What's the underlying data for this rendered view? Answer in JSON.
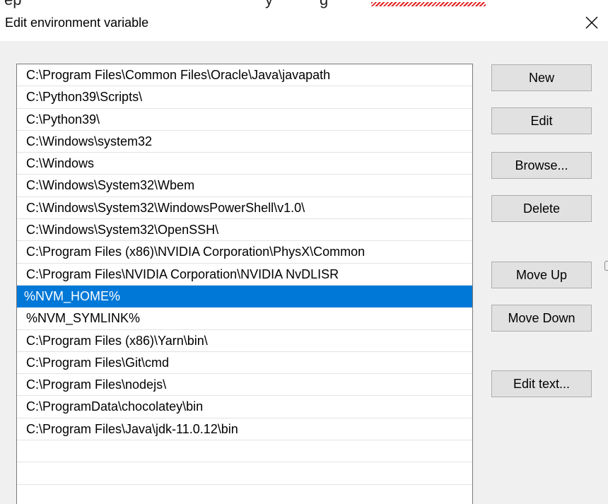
{
  "window": {
    "title": "Edit environment variable",
    "close_icon": "close-icon"
  },
  "top_fragment": {
    "left_text": "ep",
    "mid_text": "y",
    "right_text": "g"
  },
  "path_list": {
    "selected_index": 10,
    "items": [
      "C:\\Program Files\\Common Files\\Oracle\\Java\\javapath",
      "C:\\Python39\\Scripts\\",
      "C:\\Python39\\",
      "C:\\Windows\\system32",
      "C:\\Windows",
      "C:\\Windows\\System32\\Wbem",
      "C:\\Windows\\System32\\WindowsPowerShell\\v1.0\\",
      "C:\\Windows\\System32\\OpenSSH\\",
      "C:\\Program Files (x86)\\NVIDIA Corporation\\PhysX\\Common",
      "C:\\Program Files\\NVIDIA Corporation\\NVIDIA NvDLISR",
      "%NVM_HOME%",
      "%NVM_SYMLINK%",
      "C:\\Program Files (x86)\\Yarn\\bin\\",
      "C:\\Program Files\\Git\\cmd",
      "C:\\Program Files\\nodejs\\",
      "C:\\ProgramData\\chocolatey\\bin",
      "C:\\Program Files\\Java\\jdk-11.0.12\\bin"
    ]
  },
  "buttons": {
    "new": "New",
    "edit": "Edit",
    "browse": "Browse...",
    "delete": "Delete",
    "move_up": "Move Up",
    "move_down": "Move Down",
    "edit_text": "Edit text..."
  },
  "colors": {
    "selection": "#0078d7",
    "button_face": "#e1e1e1",
    "dialog_background": "#f0f0f0"
  }
}
